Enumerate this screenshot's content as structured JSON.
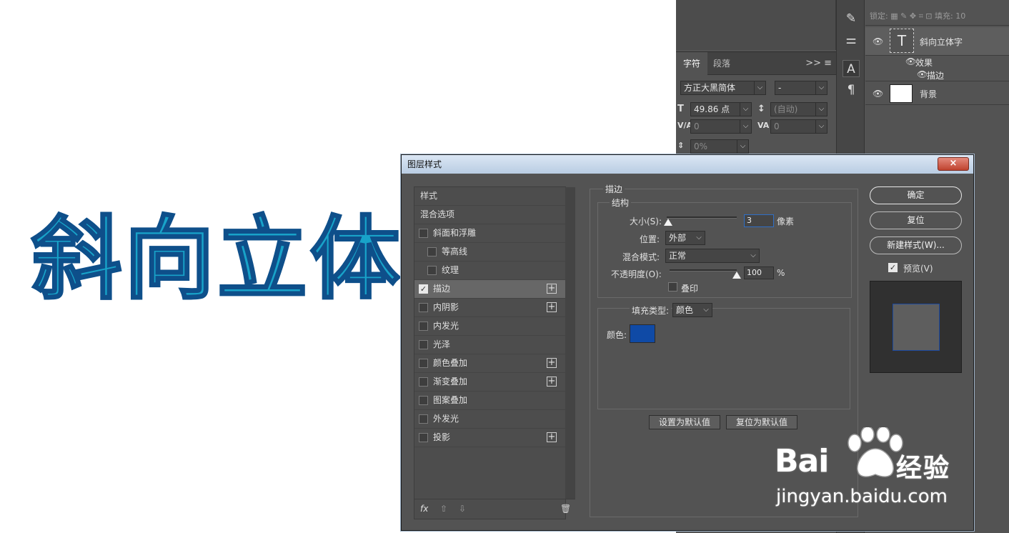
{
  "canvas": {
    "text": "斜向立体字",
    "fill_color": "#18a3c9",
    "stroke_color": "#0e4f8a"
  },
  "character_panel": {
    "tabs": [
      {
        "label": "字符",
        "active": true
      },
      {
        "label": "段落",
        "active": false
      }
    ],
    "menu_label": ">> ≡",
    "font_family": "方正大黑简体",
    "font_style": "-",
    "font_size": "49.86 点",
    "leading": "(自动)",
    "kerning": "0",
    "tracking": "0",
    "scale": "0%",
    "icons": {
      "size": "font-size-icon",
      "leading": "leading-icon",
      "kerning": "kerning-icon",
      "tracking": "tracking-icon",
      "scale": "scale-icon"
    }
  },
  "layers_panel": {
    "lock_label": "锁定:",
    "fill_label": "填充:",
    "fill_value": "10",
    "layers": [
      {
        "name": "斜向立体字",
        "thumb": "T"
      },
      {
        "name": "效果"
      },
      {
        "name": "描边"
      },
      {
        "name": "背景"
      }
    ]
  },
  "dialog": {
    "title": "图层样式",
    "close_label": "×",
    "style_list": {
      "header": "样式",
      "blend_options": "混合选项",
      "items": [
        {
          "label": "斜面和浮雕",
          "checked": false,
          "plus": false
        },
        {
          "label": "等高线",
          "checked": false,
          "plus": false
        },
        {
          "label": "纹理",
          "checked": false,
          "plus": false
        },
        {
          "label": "描边",
          "checked": true,
          "plus": true
        },
        {
          "label": "内阴影",
          "checked": false,
          "plus": true
        },
        {
          "label": "内发光",
          "checked": false,
          "plus": false
        },
        {
          "label": "光泽",
          "checked": false,
          "plus": false
        },
        {
          "label": "颜色叠加",
          "checked": false,
          "plus": true
        },
        {
          "label": "渐变叠加",
          "checked": false,
          "plus": true
        },
        {
          "label": "图案叠加",
          "checked": false,
          "plus": false
        },
        {
          "label": "外发光",
          "checked": false,
          "plus": false
        },
        {
          "label": "投影",
          "checked": false,
          "plus": true
        }
      ],
      "footer": {
        "fx": "fx",
        "up": "⇧",
        "down": "⇩",
        "trash": "🗑"
      }
    },
    "stroke": {
      "group_title": "描边",
      "structure_title": "结构",
      "size_label": "大小(S):",
      "size_value": "3",
      "size_unit": "像素",
      "size_fraction": 0.02,
      "position_label": "位置:",
      "position_value": "外部",
      "blend_label": "混合模式:",
      "blend_value": "正常",
      "opacity_label": "不透明度(O):",
      "opacity_value": "100",
      "opacity_unit": "%",
      "opacity_fraction": 1.0,
      "overprint_label": "叠印",
      "fill_type_label": "填充类型:",
      "fill_type_value": "颜色",
      "color_label": "颜色:",
      "color_value": "#0f4aa6",
      "set_default": "设置为默认值",
      "reset_default": "复位为默认值"
    },
    "buttons": {
      "ok": "确定",
      "reset": "复位",
      "new_style": "新建样式(W)...",
      "preview_label": "预览(V)",
      "preview_checked": true
    }
  },
  "watermark": {
    "brand": "Bai",
    "brand_cn": "经验",
    "url": "jingyan.baidu.com"
  }
}
